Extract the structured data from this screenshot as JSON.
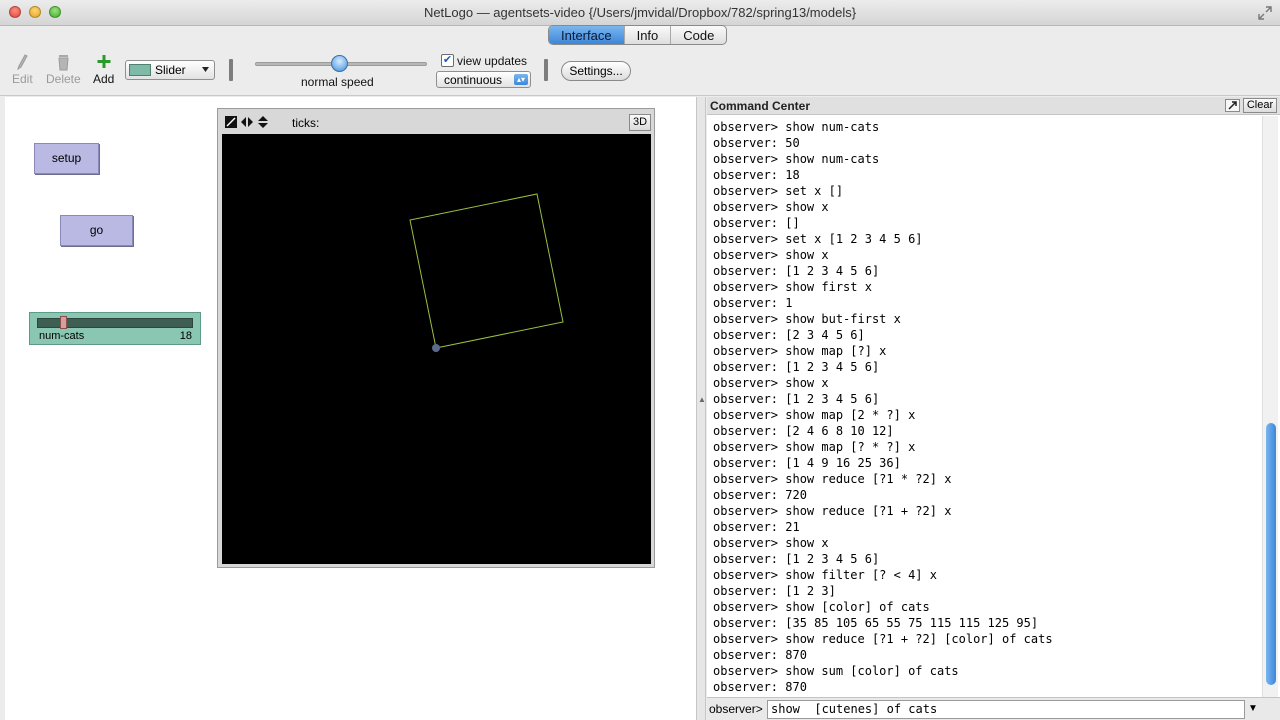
{
  "window": {
    "title": "NetLogo — agentsets-video {/Users/jmvidal/Dropbox/782/spring13/models}"
  },
  "tabs": [
    {
      "label": "Interface",
      "active": true
    },
    {
      "label": "Info",
      "active": false
    },
    {
      "label": "Code",
      "active": false
    }
  ],
  "toolbar": {
    "edit_label": "Edit",
    "delete_label": "Delete",
    "add_label": "Add",
    "widget_type": "Slider",
    "speed_label": "normal speed",
    "speed_fraction": 0.5,
    "view_updates_label": "view updates",
    "view_updates_checked": true,
    "update_mode": "continuous",
    "settings_label": "Settings..."
  },
  "interface": {
    "setup_label": "setup",
    "go_label": "go",
    "slider": {
      "name": "num-cats",
      "value": "18"
    },
    "view": {
      "ticks_label": "ticks:",
      "three_d_label": "3D"
    }
  },
  "command_center": {
    "title": "Command Center",
    "clear_label": "Clear",
    "prompt": "observer>",
    "input_value": "show  [cutenes] of cats",
    "lines": [
      "observer> show num-cats",
      "observer: 50",
      "observer> show num-cats",
      "observer: 18",
      "observer> set x []",
      "observer> show x",
      "observer: []",
      "observer> set x [1 2 3 4 5 6]",
      "observer> show x",
      "observer: [1 2 3 4 5 6]",
      "observer> show first x",
      "observer: 1",
      "observer> show but-first x",
      "observer: [2 3 4 5 6]",
      "observer> show map [?] x",
      "observer: [1 2 3 4 5 6]",
      "observer> show x",
      "observer: [1 2 3 4 5 6]",
      "observer> show map [2 * ?] x",
      "observer: [2 4 6 8 10 12]",
      "observer> show map [? * ?] x",
      "observer: [1 4 9 16 25 36]",
      "observer> show reduce [?1 * ?2] x",
      "observer: 720",
      "observer> show reduce [?1 + ?2] x",
      "observer: 21",
      "observer> show x",
      "observer: [1 2 3 4 5 6]",
      "observer> show filter [? < 4] x",
      "observer: [1 2 3]",
      "observer> show [color] of cats",
      "observer: [35 85 105 65 55 75 115 115 125 95]",
      "observer> show reduce [?1 + ?2] [color] of cats",
      "observer: 870",
      "observer> show sum [color] of cats",
      "observer: 870"
    ]
  },
  "colors": {
    "tab_active": "#3c86d9",
    "button_bg": "#b9b9e4",
    "slider_bg": "#89c7b3",
    "world_bg": "#000000",
    "turtle_line": "#9bbf3f"
  }
}
